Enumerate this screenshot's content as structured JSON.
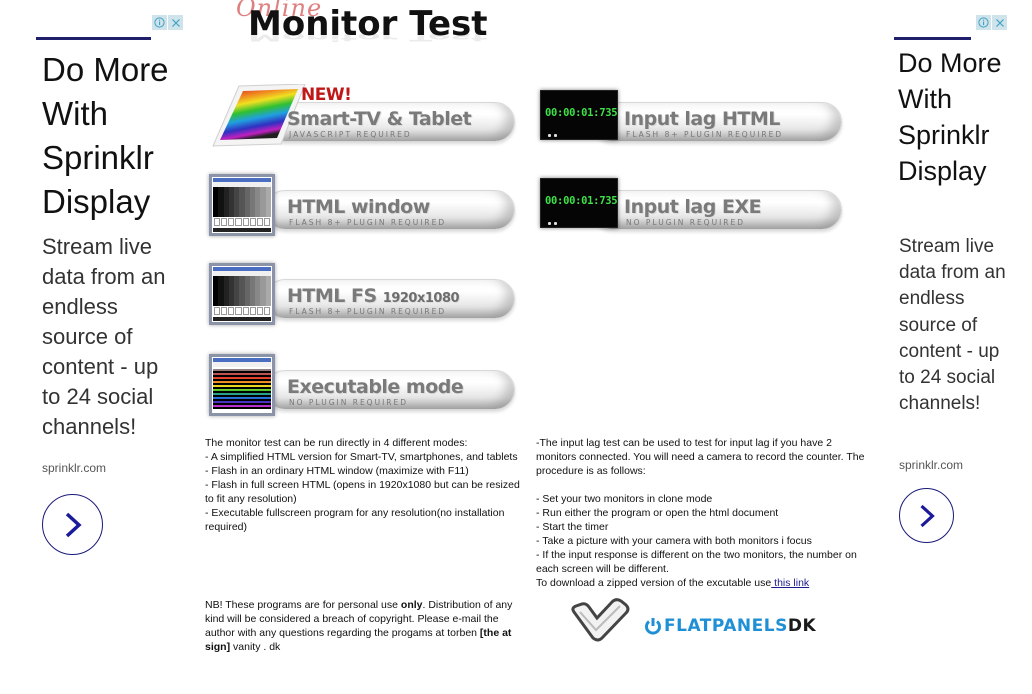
{
  "page": {
    "title_script": "Online",
    "title_main": "Monitor Test"
  },
  "modes": [
    {
      "id": "smart-tv",
      "badge": "NEW!",
      "label": "Smart-TV & Tablet",
      "sublabel": "JAVASCRIPT REQUIRED"
    },
    {
      "id": "html-window",
      "label": "HTML window",
      "sublabel": "FLASH 8+ PLUGIN REQUIRED"
    },
    {
      "id": "html-fs",
      "label": "HTML FS",
      "label_suffix": "1920x1080",
      "sublabel": "FLASH 8+ PLUGIN REQUIRED"
    },
    {
      "id": "executable",
      "label": "Executable mode",
      "sublabel": "NO PLUGIN REQUIRED"
    },
    {
      "id": "input-lag-html",
      "label": "Input lag HTML",
      "sublabel": "FLASH 8+ PLUGIN REQUIRED",
      "timer": "00:00:01:735"
    },
    {
      "id": "input-lag-exe",
      "label": "Input lag EXE",
      "sublabel": "NO PLUGIN REQUIRED",
      "timer": "00:00:01:735"
    }
  ],
  "modes_description": {
    "intro": "The monitor test can be run directly in 4 different modes:",
    "items": [
      "- A simplified HTML version for Smart-TV, smartphones, and tablets",
      "- Flash in an ordinary HTML window (maximize with F11)",
      "- Flash in full screen HTML (opens in 1920x1080 but can be resized to fit any resolution)",
      "- Executable fullscreen program for any resolution(no installation required)"
    ]
  },
  "input_lag_description": {
    "intro": "-The input lag test can be used to test for input lag if you have 2 monitors connected. You will need a camera to record the counter. The procedure is as follows:",
    "steps": [
      "- Set your two monitors in clone mode",
      "- Run either the program or open the html document",
      "- Start the timer",
      "- Take a picture with your camera with both monitors i focus",
      "- If the input response is different on the two monitors, the number on each screen will be different."
    ],
    "download_text": "To download a zipped version of the excutable use",
    "download_link": " this link"
  },
  "notice": {
    "part1": "NB! These programs are for personal use ",
    "bold1": "only",
    "part2": ". Distribution of any kind will be considered a breach of copyright. Please e-mail the author with any questions regarding the progams at torben ",
    "bold2": "[the at sign]",
    "part3": " vanity . dk"
  },
  "logo": {
    "brand": "FLATPANELS",
    "suffix": "DK"
  },
  "ads": {
    "left": {
      "headline": "Do More With Sprinklr Display",
      "body": "Stream live data from an endless source of content - up to 24 social channels!",
      "domain": "sprinklr.com"
    },
    "right": {
      "headline": "Do More With Sprinklr Display",
      "body": "Stream live data from an endless source of content - up to 24 social channels!",
      "domain": "sprinklr.com"
    },
    "colors": {
      "rule": "#1f1f6b",
      "cta": "#1a1a9a",
      "control_bg": "#cfe3ea"
    }
  }
}
